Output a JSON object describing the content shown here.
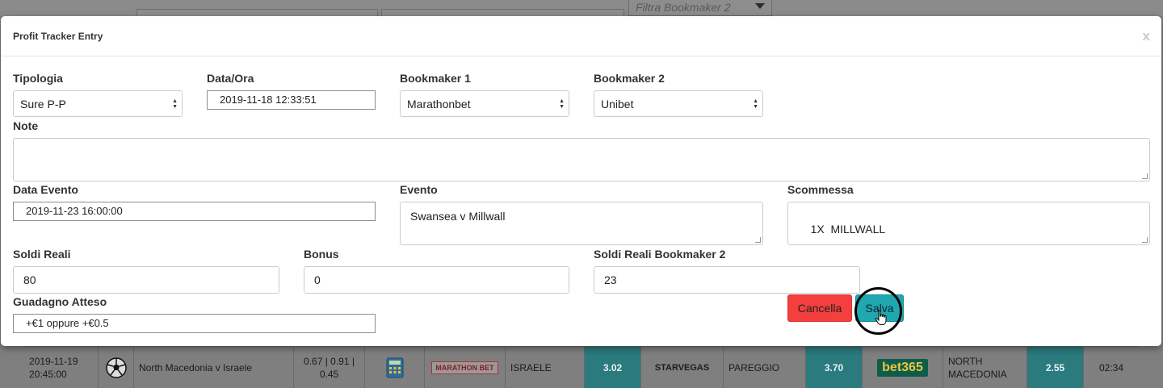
{
  "background": {
    "filter_placeholder": "Filtra Bookmaker 2",
    "row": {
      "datetime_line1": "2019-11-19",
      "datetime_line2": "20:45:00",
      "event": "North Macedonia v Israele",
      "probabilities_line1": "0.67 | 0.91 |",
      "probabilities_line2": "0.45",
      "bookmaker1_logo": "MARATHON BET",
      "bet1": "ISRAELE",
      "odds1": "3.02",
      "bookmaker2_logo": "STARVEGAS",
      "bet2": "PAREGGIO",
      "odds2": "3.70",
      "bookmaker3_logo": "bet365",
      "bet3_line1": "NORTH",
      "bet3_line2": "MACEDONIA",
      "odds3": "2.55",
      "time": "02:34"
    }
  },
  "modal": {
    "title": "Profit Tracker Entry",
    "close_label": "x",
    "fields": {
      "tipologia": {
        "label": "Tipologia",
        "value": "Sure P-P"
      },
      "data_ora": {
        "label": "Data/Ora",
        "value": "2019-11-18 12:33:51"
      },
      "bookmaker1": {
        "label": "Bookmaker 1",
        "value": "Marathonbet"
      },
      "bookmaker2": {
        "label": "Bookmaker 2",
        "value": "Unibet"
      },
      "note": {
        "label": "Note",
        "value": ""
      },
      "data_evento": {
        "label": "Data Evento",
        "value": "2019-11-23 16:00:00"
      },
      "evento": {
        "label": "Evento",
        "value": "Swansea v Millwall"
      },
      "scommessa": {
        "label": "Scommessa",
        "value": "1X  MILLWALL"
      },
      "soldi_reali": {
        "label": "Soldi Reali",
        "value": "80"
      },
      "bonus": {
        "label": "Bonus",
        "value": "0"
      },
      "soldi_reali_bk2": {
        "label": "Soldi Reali Bookmaker 2",
        "value": "23"
      },
      "guadagno_atteso": {
        "label": "Guadagno Atteso",
        "value": "+€1 oppure +€0.5"
      }
    },
    "buttons": {
      "cancel": "Cancella",
      "save": "Salva"
    }
  },
  "colors": {
    "cancel": "#f43f3f",
    "save": "#1fa8b0",
    "odds_bg": "#2a7a7e"
  }
}
